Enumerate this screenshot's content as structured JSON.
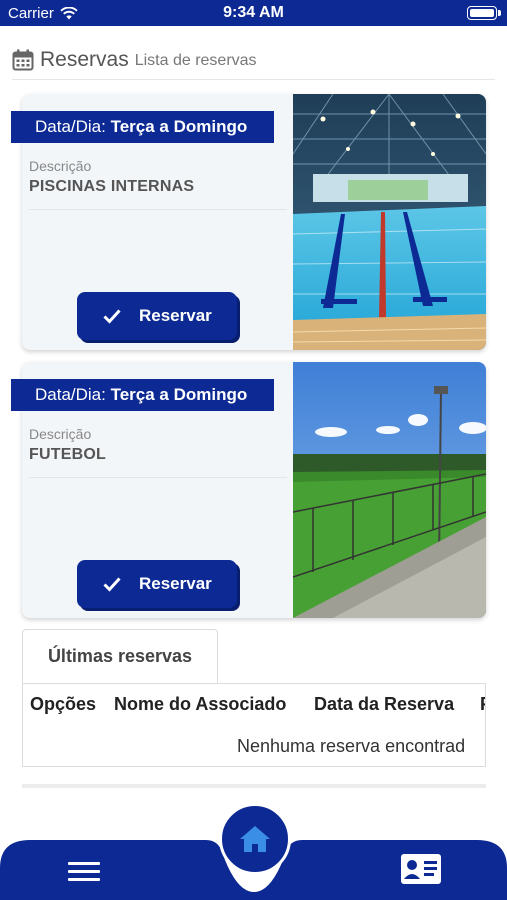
{
  "status_bar": {
    "carrier": "Carrier",
    "time": "9:34 AM"
  },
  "header": {
    "title": "Reservas",
    "subtitle": "Lista de reservas"
  },
  "cards": [
    {
      "day_label": "Data/Dia:",
      "day_value": "Terça a Domingo",
      "desc_label": "Descrição",
      "desc_value": "PISCINAS INTERNAS",
      "button_label": "Reservar"
    },
    {
      "day_label": "Data/Dia:",
      "day_value": "Terça a Domingo",
      "desc_label": "Descrição",
      "desc_value": "FUTEBOL",
      "button_label": "Reservar"
    }
  ],
  "last_reservations": {
    "tab_label": "Últimas reservas",
    "columns": [
      "Opções",
      "Nome do Associado",
      "Data da Reserva",
      "F"
    ],
    "empty_message": "Nenhuma reserva encontrad"
  },
  "bottom_nav": {
    "icons": [
      "menu-icon",
      "home-icon",
      "id-card-icon"
    ]
  },
  "colors": {
    "primary": "#0d2a94",
    "card_bg": "#f3f6f9"
  }
}
